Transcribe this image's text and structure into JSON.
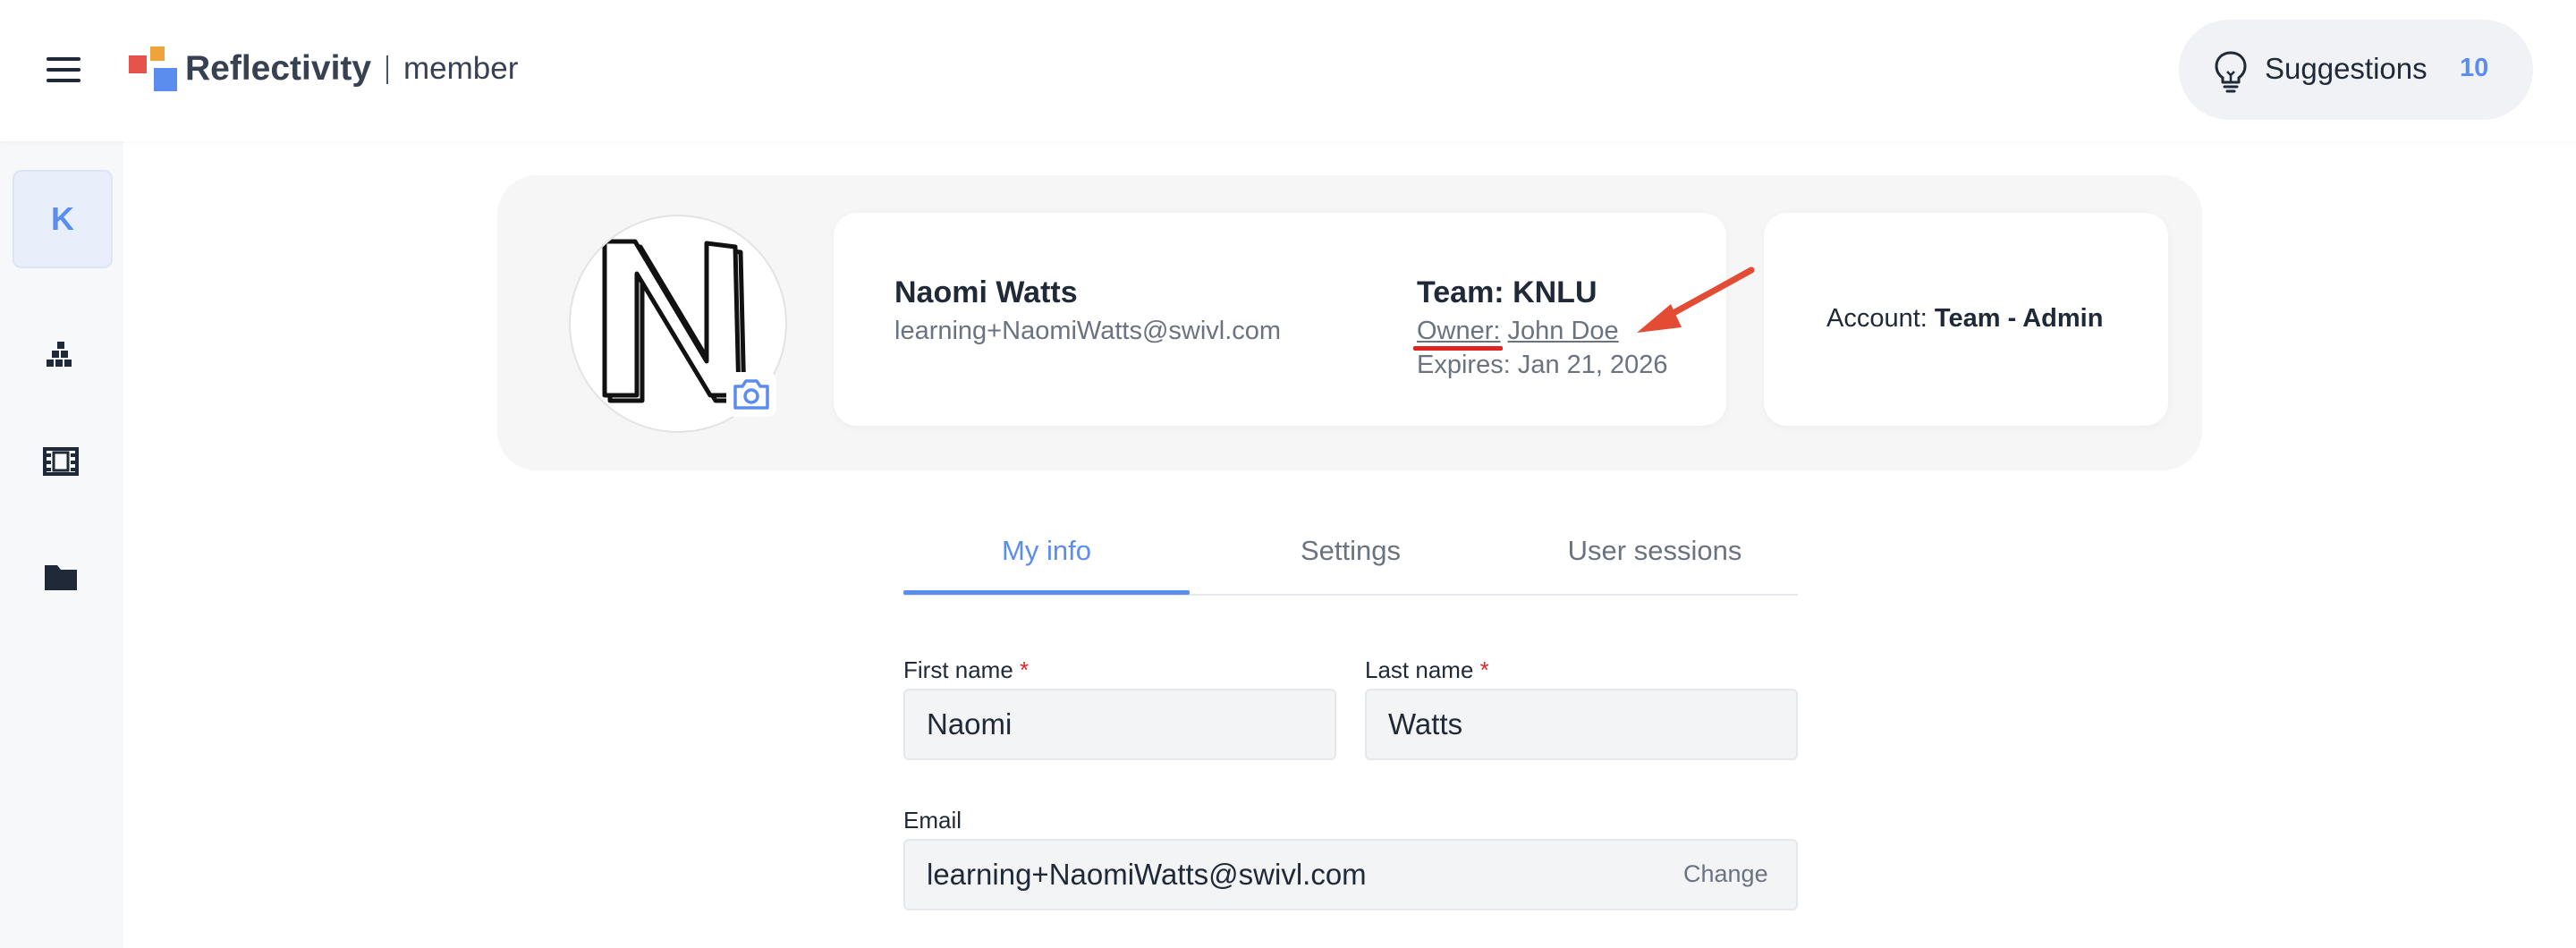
{
  "header": {
    "brand": "Reflectivity",
    "role": "member",
    "suggestions_label": "Suggestions",
    "suggestions_count": "10",
    "logo_colors": [
      "#e5534b",
      "#f0a33a",
      "#5b8def"
    ]
  },
  "sidebar": {
    "avatar_letter": "K",
    "items": [
      {
        "icon": "bar-chart-icon"
      },
      {
        "icon": "film-icon"
      },
      {
        "icon": "folder-icon"
      }
    ]
  },
  "profile": {
    "name": "Naomi Watts",
    "email": "learning+NaomiWatts@swivl.com",
    "team": "Team: KNLU",
    "owner_label": "Owner:",
    "owner_name": "John Doe",
    "expires": "Expires: Jan 21, 2026",
    "account_label": "Account:",
    "account_value": "Team - Admin",
    "avatar_letter": "N"
  },
  "tabs": [
    {
      "label": "My info",
      "active": true
    },
    {
      "label": "Settings",
      "active": false
    },
    {
      "label": "User sessions",
      "active": false
    }
  ],
  "form": {
    "first_name_label": "First name",
    "first_name_value": "Naomi",
    "last_name_label": "Last name",
    "last_name_value": "Watts",
    "required_marker": "*",
    "email_label": "Email",
    "email_value": "learning+NaomiWatts@swivl.com",
    "change_label": "Change"
  },
  "colors": {
    "accent": "#5b8def",
    "annotation_red": "#e02424"
  }
}
